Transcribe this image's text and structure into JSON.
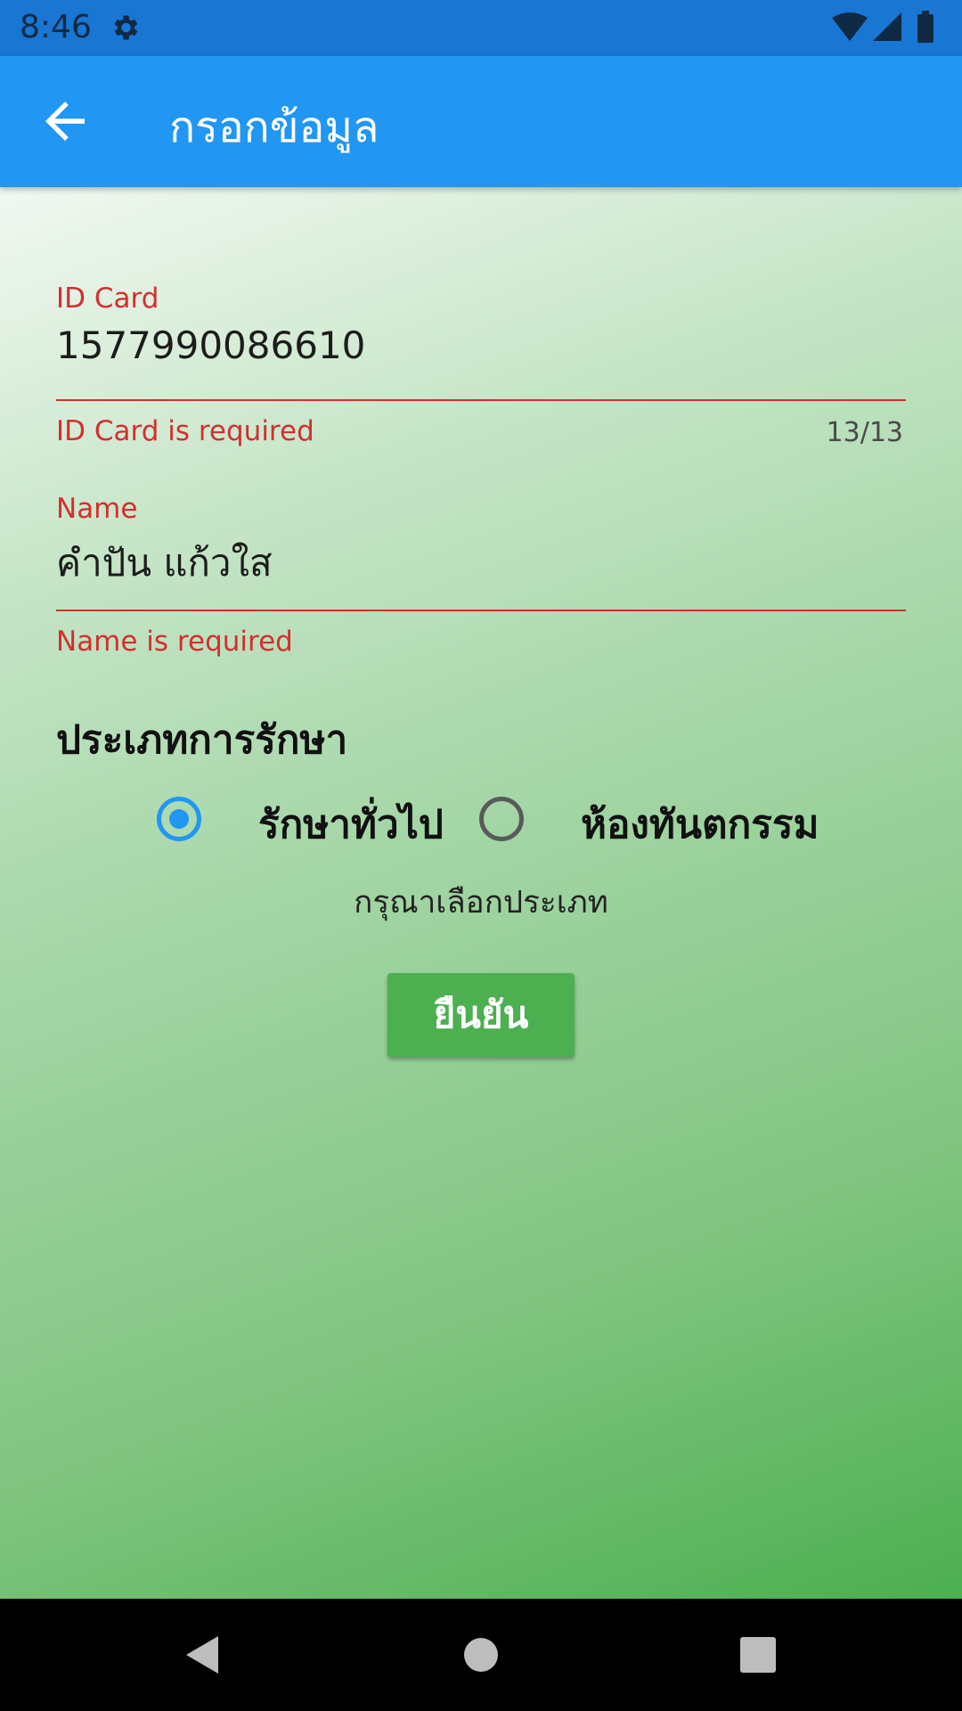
{
  "status_bar": {
    "time": "8:46",
    "icons": [
      "settings-gear-icon",
      "wifi-icon",
      "signal-icon",
      "battery-icon"
    ],
    "color": "#1976D2"
  },
  "app_bar": {
    "title": "กรอกข้อมูล",
    "back_icon": "arrow-back-icon",
    "color": "#2196F3"
  },
  "form": {
    "id_card": {
      "label": "ID Card",
      "value": "1577990086610",
      "error": "ID Card is required",
      "counter": "13/13"
    },
    "name": {
      "label": "Name",
      "value": "คำปัน แก้วใส",
      "error": "Name is required"
    },
    "error_color": "#D32F2F"
  },
  "treatment": {
    "title": "ประเภทการรักษา",
    "options": [
      {
        "label": "รักษาทั่วไป",
        "selected": true
      },
      {
        "label": "ห้องทันตกรรม",
        "selected": false
      }
    ],
    "hint": "กรุณาเลือกประเภท"
  },
  "confirm": {
    "label": "ยืนยัน",
    "color": "#4CAF50"
  },
  "nav_bar": {
    "icons": [
      "nav-back-icon",
      "nav-home-icon",
      "nav-recents-icon"
    ]
  }
}
